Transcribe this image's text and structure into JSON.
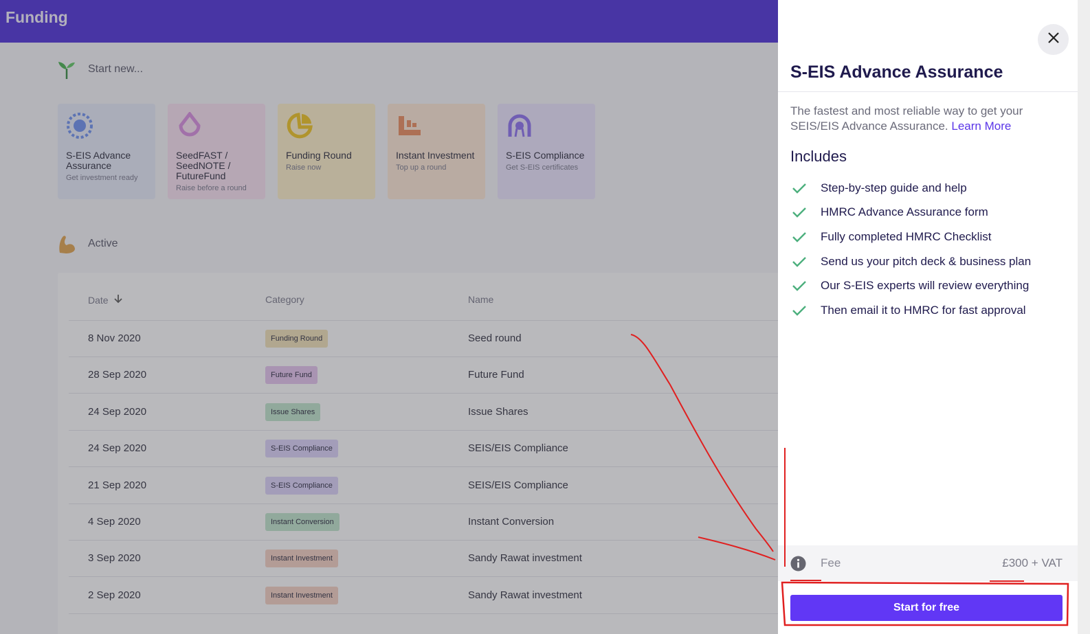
{
  "app": {
    "title": "Funding"
  },
  "start_new": {
    "heading": "Start new..."
  },
  "cards": [
    {
      "name": "S-EIS Advance Assurance",
      "sub": "Get investment ready"
    },
    {
      "name": "SeedFAST / SeedNOTE / FutureFund",
      "sub": "Raise before a round"
    },
    {
      "name": "Funding Round",
      "sub": "Raise now"
    },
    {
      "name": "Instant Investment",
      "sub": "Top up a round"
    },
    {
      "name": "S-EIS Compliance",
      "sub": "Get S-EIS certificates"
    }
  ],
  "active": {
    "heading": "Active",
    "columns": {
      "date": "Date",
      "sort_icon": "arrow-down",
      "category": "Category",
      "name": "Name"
    },
    "rows": [
      {
        "date": "8 Nov 2020",
        "category": "Funding Round",
        "cat_color": "#f2e3b6",
        "name": "Seed round"
      },
      {
        "date": "28 Sep 2020",
        "category": "Future Fund",
        "cat_color": "#e6c4ef",
        "name": "Future Fund"
      },
      {
        "date": "24 Sep 2020",
        "category": "Issue Shares",
        "cat_color": "#bfe6cc",
        "name": "Issue Shares"
      },
      {
        "date": "24 Sep 2020",
        "category": "S-EIS Compliance",
        "cat_color": "#dcd2fb",
        "name": "SEIS/EIS Compliance"
      },
      {
        "date": "21 Sep 2020",
        "category": "S-EIS Compliance",
        "cat_color": "#dcd2fb",
        "name": "SEIS/EIS Compliance"
      },
      {
        "date": "4 Sep 2020",
        "category": "Instant Conversion",
        "cat_color": "#bfe6cc",
        "name": "Instant Conversion"
      },
      {
        "date": "3 Sep 2020",
        "category": "Instant Investment",
        "cat_color": "#f5d0c2",
        "name": "Sandy Rawat investment"
      },
      {
        "date": "2 Sep 2020",
        "category": "Instant Investment",
        "cat_color": "#f5d0c2",
        "name": "Sandy Rawat investment"
      }
    ]
  },
  "drawer": {
    "title": "S-EIS Advance Assurance",
    "description": "The fastest and most reliable way to get your SEIS/EIS Advance Assurance.",
    "learn_more": "Learn More",
    "includes_heading": "Includes",
    "includes": [
      "Step-by-step guide and help",
      "HMRC Advance Assurance form",
      "Fully completed HMRC Checklist",
      "Send us your pitch deck & business plan",
      "Our S-EIS experts will review everything",
      "Then email it to HMRC for fast approval"
    ],
    "fee_label": "Fee",
    "fee_value": "£300 + VAT",
    "cta": "Start for free"
  },
  "colors": {
    "brand": "#4a2bd8",
    "cta": "#6137f5",
    "check": "#4caf7d",
    "annotation": "#e02020"
  }
}
